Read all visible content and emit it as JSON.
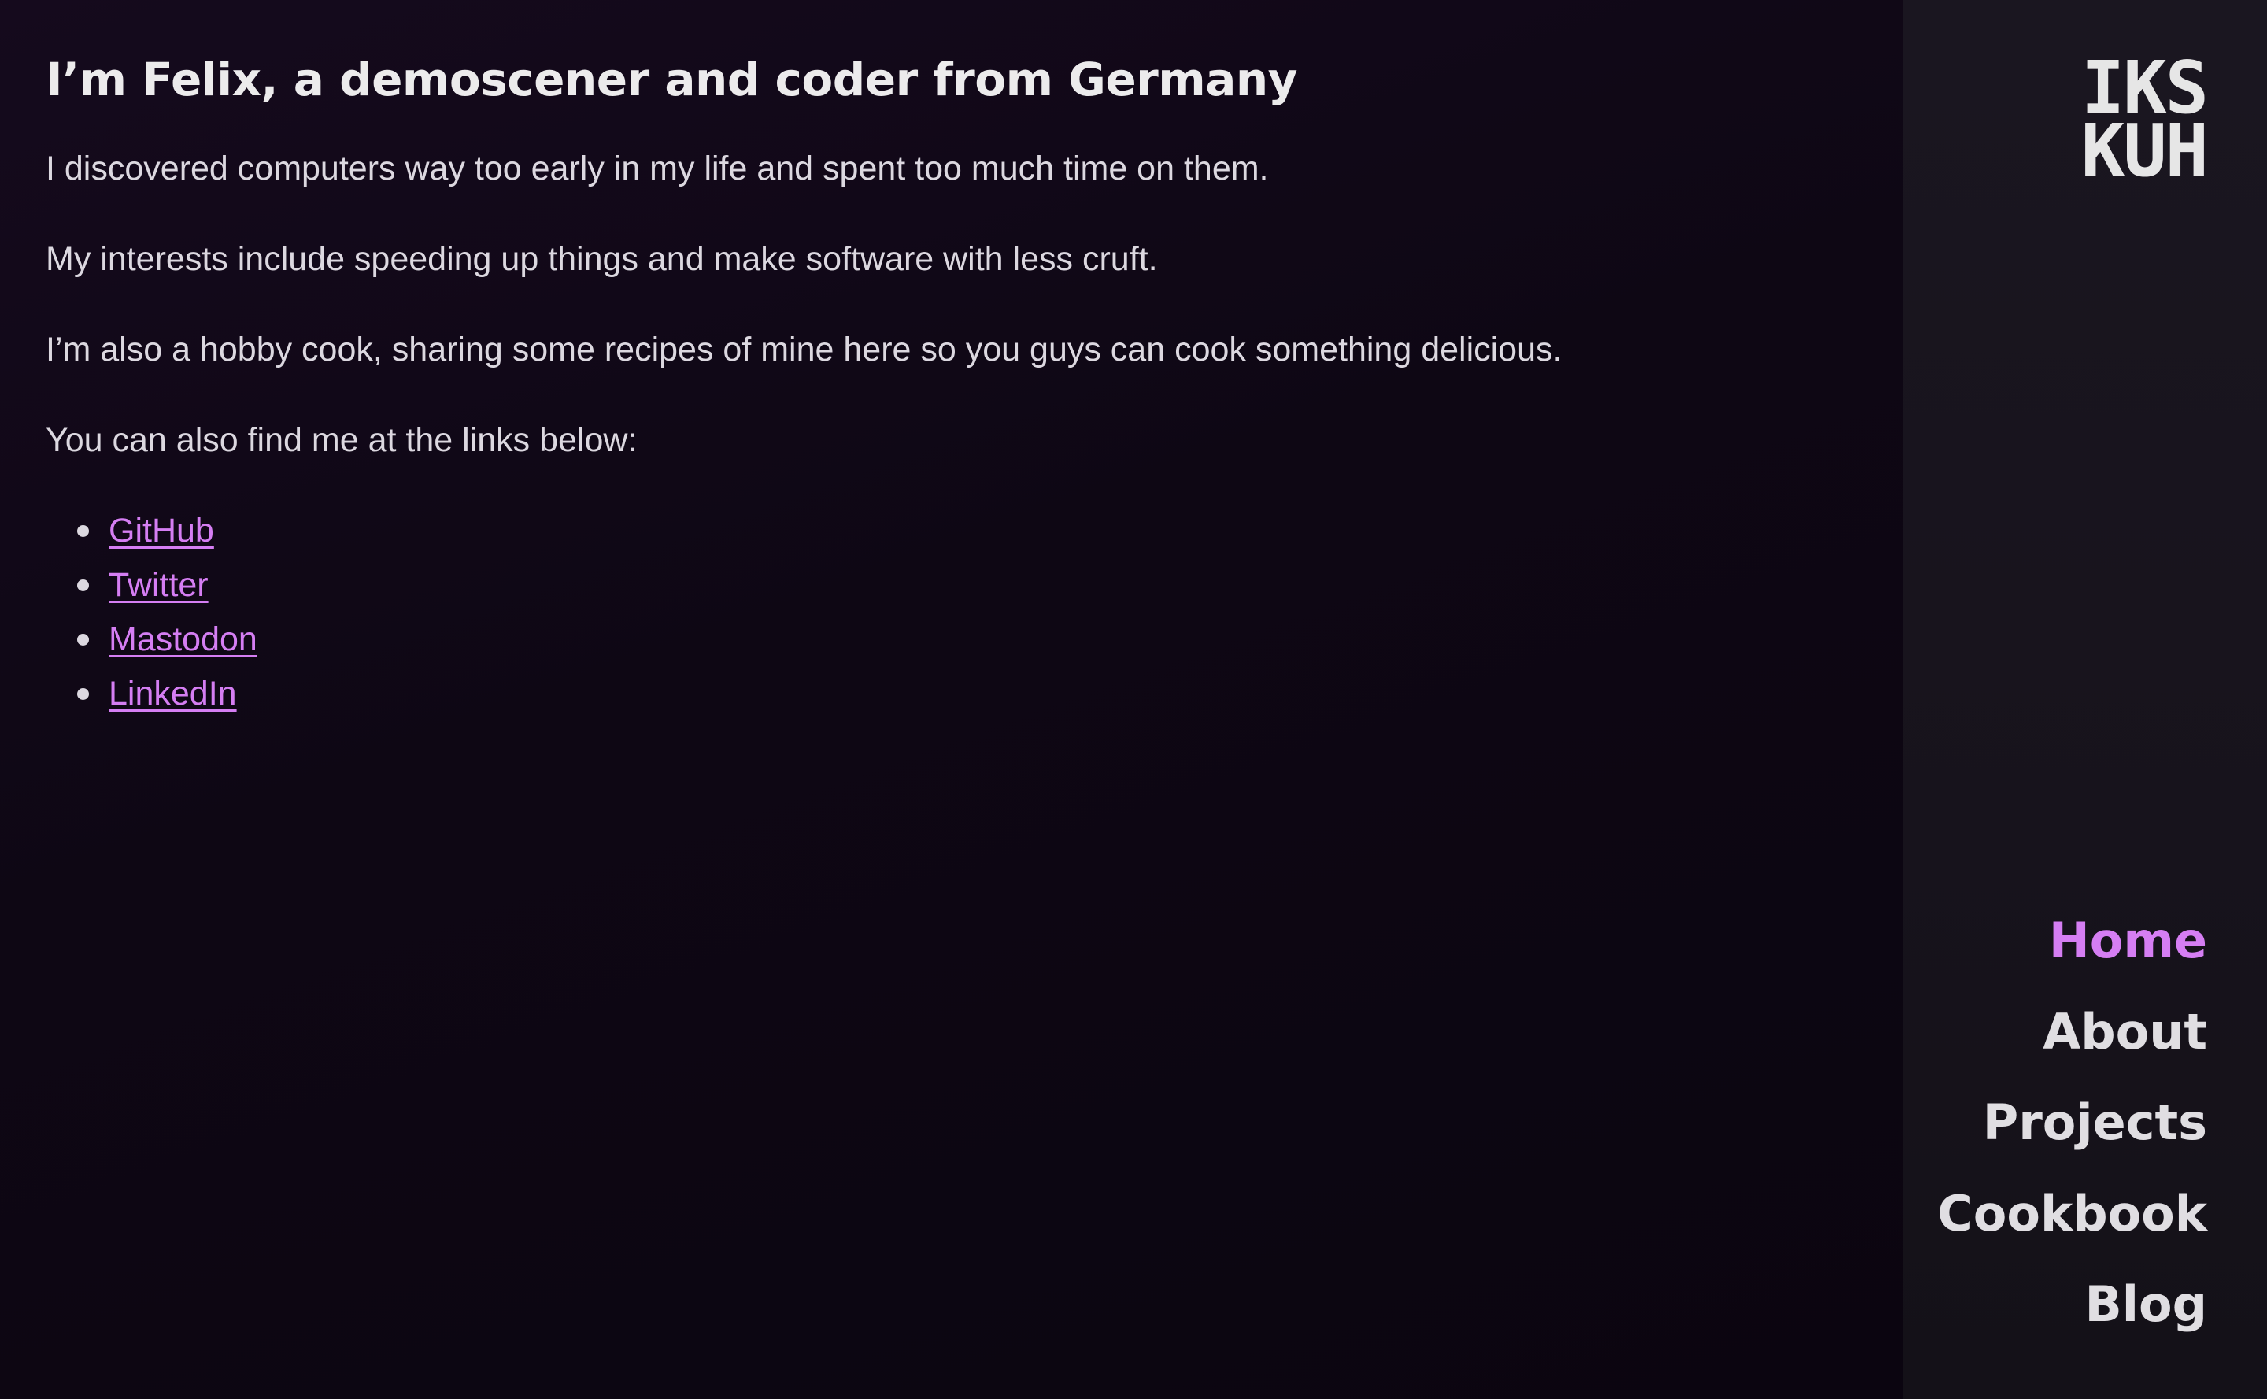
{
  "main": {
    "heading": "I’m Felix, a demoscener and coder from Germany",
    "paragraphs": [
      "I discovered computers way too early in my life and spent too much time on them.",
      "My interests include speeding up things and make software with less cruft.",
      "I’m also a hobby cook, sharing some recipes of mine here so you guys can cook something delicious.",
      "You can also find me at the links below:"
    ],
    "links": [
      {
        "label": "GitHub"
      },
      {
        "label": "Twitter"
      },
      {
        "label": "Mastodon"
      },
      {
        "label": "LinkedIn"
      }
    ]
  },
  "sidebar": {
    "logo": {
      "line1": "IKS",
      "line2": "KUH"
    },
    "nav": [
      {
        "label": "Home",
        "active": true
      },
      {
        "label": "About",
        "active": false
      },
      {
        "label": "Projects",
        "active": false
      },
      {
        "label": "Cookbook",
        "active": false
      },
      {
        "label": "Blog",
        "active": false
      }
    ]
  },
  "colors": {
    "accent": "#d57ef3",
    "background": "#0d0613",
    "sidebar_background": "#17131c",
    "text": "#dcd8e0"
  }
}
